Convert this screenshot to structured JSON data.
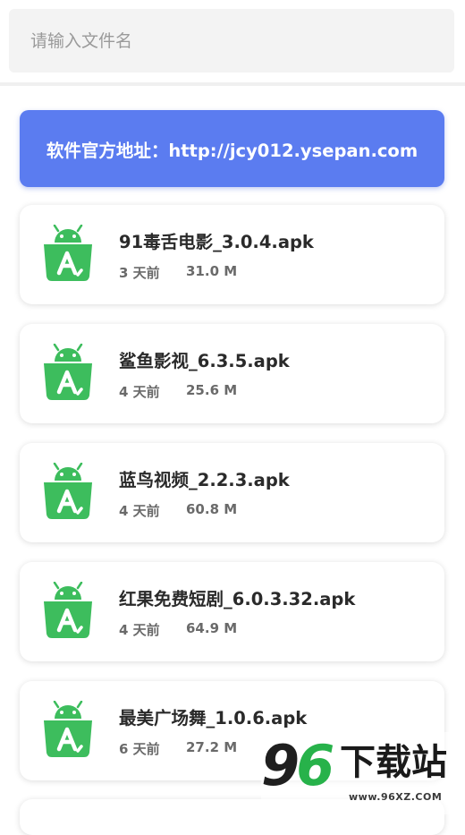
{
  "search": {
    "placeholder": "请输入文件名",
    "value": ""
  },
  "banner": {
    "text": "软件官方地址：http://jcy012.ysepan.com"
  },
  "files": [
    {
      "name": "91毒舌电影_3.0.4.apk",
      "age": "3 天前",
      "size": "31.0 M"
    },
    {
      "name": "鲨鱼影视_6.3.5.apk",
      "age": "4 天前",
      "size": "25.6 M"
    },
    {
      "name": "蓝鸟视频_2.2.3.apk",
      "age": "4 天前",
      "size": "60.8 M"
    },
    {
      "name": "红果免费短剧_6.0.3.32.apk",
      "age": "4 天前",
      "size": "64.9 M"
    },
    {
      "name": "最美广场舞_1.0.6.apk",
      "age": "6 天前",
      "size": "27.2 M"
    }
  ],
  "icons": {
    "file": "android-apk-icon"
  },
  "watermark": {
    "digits_a": "9",
    "digits_b": "6",
    "text": "下载站",
    "url": "www.96XZ.COM"
  },
  "colors": {
    "banner": "#5b7cf0",
    "apk_icon": "#3dbd5d",
    "search_bg": "#f3f3f3"
  }
}
